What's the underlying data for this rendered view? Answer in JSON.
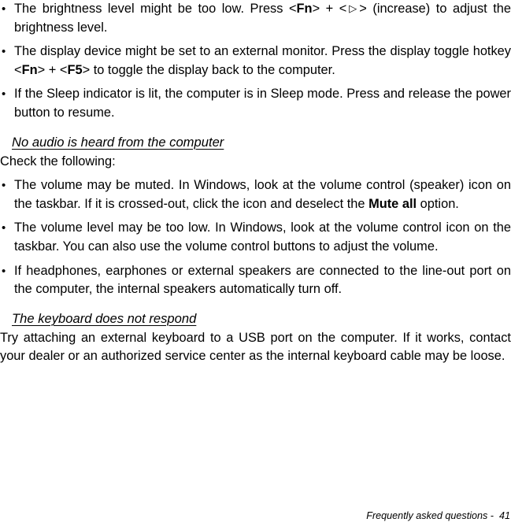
{
  "document": {
    "footer": "Frequently asked questions -  41",
    "bullet_glyph": "•",
    "triangle_glyph": "▷"
  },
  "blocks": {
    "display_bullets": [
      {
        "id": "brightness",
        "parts": [
          {
            "t": "The brightness level might be too low. Press <",
            "style": "normal"
          },
          {
            "t": "Fn",
            "style": "bold"
          },
          {
            "t": "> + <",
            "style": "normal"
          },
          {
            "t": "▷",
            "style": "triangle"
          },
          {
            "t": "> (increase) to adjust the brightness level.",
            "style": "normal"
          }
        ],
        "plain": "The brightness level might be too low. Press <Fn> + <▷> (increase) to adjust the brightness level."
      },
      {
        "id": "external-monitor",
        "parts": [
          {
            "t": "The display device might be set to an external monitor. Press the display toggle hotkey <",
            "style": "normal"
          },
          {
            "t": "Fn",
            "style": "bold"
          },
          {
            "t": "> + <",
            "style": "normal"
          },
          {
            "t": "F5",
            "style": "bold"
          },
          {
            "t": "> to toggle the display back to the computer.",
            "style": "normal"
          }
        ],
        "plain": "The display device might be set to an external monitor. Press the display toggle hotkey <Fn> + <F5> to toggle the display back to the computer."
      },
      {
        "id": "sleep-indicator",
        "parts": [
          {
            "t": "If the Sleep indicator is lit, the computer is in Sleep mode. Press and release the power button to resume.",
            "style": "normal"
          }
        ],
        "plain": "If the Sleep indicator is lit, the computer is in Sleep mode. Press and release the power button to resume."
      }
    ],
    "audio_heading": "No audio is heard from the computer",
    "audio_intro": "Check the following:",
    "audio_bullets": [
      {
        "id": "muted",
        "parts": [
          {
            "t": "The volume may be muted. In Windows, look at the volume control (speaker) icon on the taskbar. If it is crossed-out, click the icon and deselect the ",
            "style": "normal"
          },
          {
            "t": "Mute all",
            "style": "bold"
          },
          {
            "t": " option.",
            "style": "normal"
          }
        ],
        "plain": "The volume may be muted. In Windows, look at the volume control (speaker) icon on the taskbar. If it is crossed-out, click the icon and deselect the Mute all option."
      },
      {
        "id": "volume-low",
        "parts": [
          {
            "t": "The volume level may be too low. In Windows, look at the volume control icon on the taskbar. You can also use the volume control buttons to adjust the volume.",
            "style": "normal"
          }
        ],
        "plain": "The volume level may be too low. In Windows, look at the volume control icon on the taskbar. You can also use the volume control buttons to adjust the volume."
      },
      {
        "id": "headphones",
        "parts": [
          {
            "t": "If headphones, earphones or external speakers are connected to the line-out port on the computer, the internal speakers automatically turn off.",
            "style": "normal"
          }
        ],
        "plain": "If headphones, earphones or external speakers are connected to the line-out port on the computer, the internal speakers automatically turn off."
      }
    ],
    "keyboard_heading": "The keyboard does not respond",
    "keyboard_para": "Try attaching an external keyboard to a USB port on the computer. If it works, contact your dealer or an authorized service center as the internal keyboard cable may be loose."
  }
}
